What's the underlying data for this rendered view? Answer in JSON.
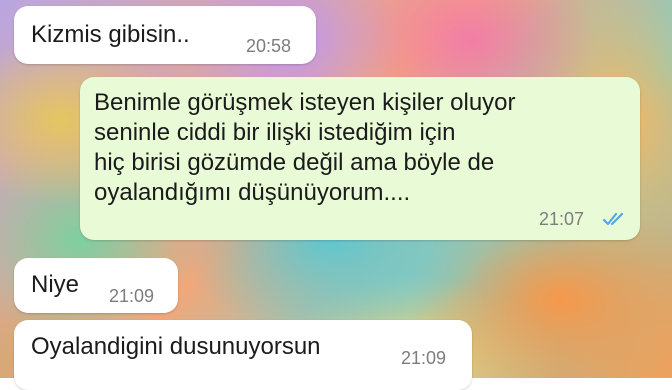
{
  "chat": {
    "messages": [
      {
        "direction": "incoming",
        "text": "Kizmis gibisin..",
        "time": "20:58"
      },
      {
        "direction": "outgoing",
        "lines": [
          "Benimle görüşmek isteyen kişiler oluyor",
          "seninle ciddi bir ilişki istediğim için",
          "hiç birisi gözümde değil ama böyle de",
          "oyalandığımı düşünüyorum...."
        ],
        "time": "21:07",
        "status": "read",
        "status_icon": "double-check-icon",
        "status_color": "#4fa9e8"
      },
      {
        "direction": "incoming",
        "text": "Niye",
        "time": "21:09"
      },
      {
        "direction": "incoming",
        "text": "Oyalandigini dusunuyorsun",
        "time": "21:09"
      }
    ]
  },
  "colors": {
    "incoming_bubble": "#ffffff",
    "outgoing_bubble": "#e9fbd6",
    "timestamp": "#7d7d7d",
    "read_ticks": "#4fa9e8"
  }
}
